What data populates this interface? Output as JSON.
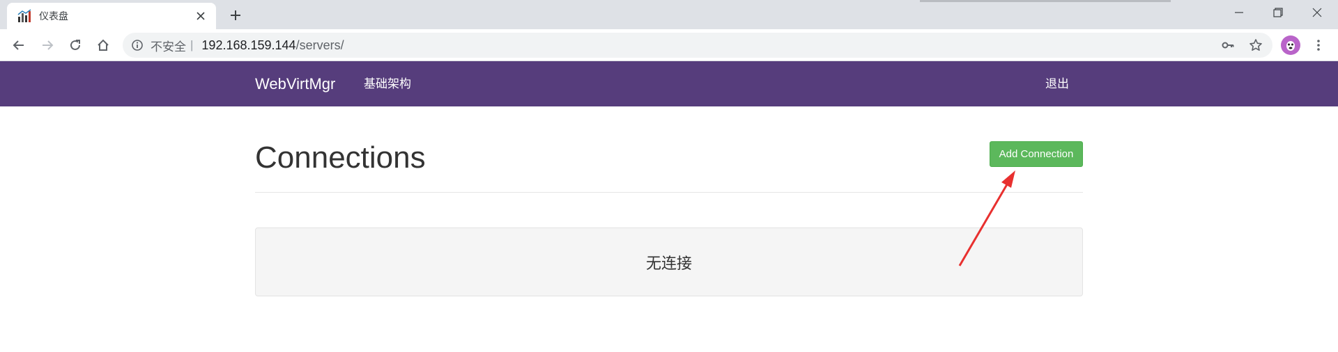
{
  "browser": {
    "tab": {
      "title": "仪表盘",
      "favicon": "chart-favicon-icon"
    },
    "address": {
      "security_label": "不安全",
      "separator": "|",
      "host": "192.168.159.144",
      "path": "/servers/"
    },
    "profile_color": "#b964c9"
  },
  "navbar": {
    "brand": "WebVirtMgr",
    "links": [
      {
        "label": "基础架构"
      }
    ],
    "logout": "退出",
    "background": "#563d7c"
  },
  "page": {
    "title": "Connections",
    "add_button": "Add Connection",
    "add_button_color": "#5cb85c",
    "empty_message": "无连接"
  },
  "annotation": {
    "arrow_color": "#e8302f",
    "icon": "red-arrow-icon"
  }
}
